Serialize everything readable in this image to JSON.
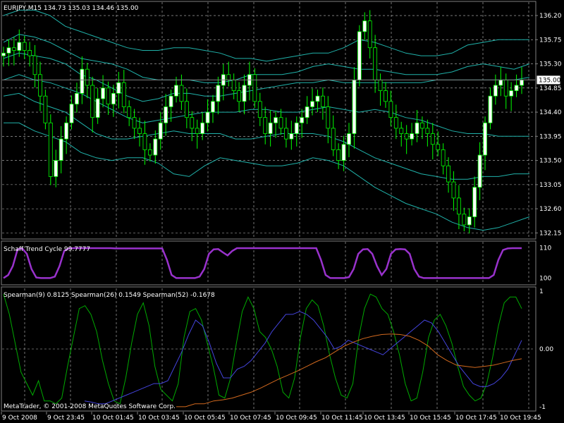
{
  "colors": {
    "background": "#000000",
    "grid": "#c0c0c0",
    "axis_text": "#ffffff",
    "bull_candle": "#ffffff",
    "bear_candle": "#000000",
    "candle_outline": "#00ff00",
    "bands": "#20b2aa",
    "schaff": "#9932cc",
    "spearman_9": "#00aa00",
    "spearman_26": "#4444dd",
    "spearman_52": "#d2691e"
  },
  "header": {
    "symbol_line": "EURJPY,M15  134.73 135.03 134.46 135.00"
  },
  "panels": {
    "schaff_label": "Schaff Trend Cycle 99.7777",
    "spearman_label": "Spearman(9) 0.8125  Spearman(26) 0.1549  Spearman(52) -0.1678",
    "copyright": "MetaTrader, © 2001-2008 MetaQuotes Software Corp."
  },
  "chart_data": [
    {
      "type": "candlestick",
      "title": "EURJPY,M15",
      "ohlc_header": {
        "open": 134.73,
        "high": 135.03,
        "low": 134.46,
        "close": 135.0
      },
      "current_price": "135.00",
      "ylim": [
        132.05,
        136.45
      ],
      "y_ticks": [
        "136.20",
        "135.75",
        "135.30",
        "134.85",
        "134.40",
        "133.95",
        "133.50",
        "133.05",
        "132.60",
        "132.15"
      ],
      "y_tick_values": [
        136.2,
        135.75,
        135.3,
        134.85,
        134.4,
        133.95,
        133.5,
        133.05,
        132.6,
        132.15
      ],
      "x_labels": [
        "9 Oct 2008",
        "9 Oct 23:45",
        "10 Oct 01:45",
        "10 Oct 03:45",
        "10 Oct 05:45",
        "10 Oct 07:45",
        "10 Oct 09:45",
        "10 Oct 11:45",
        "10 Oct 13:45",
        "10 Oct 15:45",
        "10 Oct 17:45",
        "10 Oct 19:45"
      ],
      "closes": [
        135.5,
        135.6,
        135.55,
        135.7,
        135.55,
        135.45,
        135.1,
        134.7,
        134.2,
        133.2,
        133.5,
        133.9,
        134.2,
        134.55,
        134.75,
        135.2,
        134.9,
        134.3,
        134.65,
        134.85,
        134.55,
        134.75,
        134.95,
        134.5,
        134.3,
        134.1,
        134.0,
        133.7,
        133.6,
        133.9,
        134.2,
        134.5,
        134.7,
        134.9,
        134.6,
        134.3,
        134.1,
        134.0,
        134.2,
        134.4,
        134.6,
        134.9,
        135.1,
        135.0,
        134.8,
        134.6,
        134.9,
        135.1,
        134.6,
        134.3,
        134.0,
        134.2,
        134.3,
        134.1,
        133.9,
        134.0,
        134.2,
        134.3,
        134.5,
        134.6,
        134.7,
        134.5,
        134.1,
        133.7,
        133.5,
        133.8,
        134.0,
        135.0,
        135.9,
        136.1,
        135.6,
        135.0,
        134.8,
        134.6,
        134.3,
        134.1,
        134.0,
        133.9,
        134.0,
        134.2,
        134.1,
        134.0,
        133.8,
        133.7,
        133.4,
        133.1,
        132.8,
        132.5,
        132.3,
        132.45,
        133.0,
        133.6,
        134.2,
        134.7,
        134.9,
        135.0,
        134.7,
        134.8,
        134.9,
        135.0
      ],
      "bands": [
        [
          136.2,
          136.3,
          136.3,
          136.2,
          136.0,
          135.9,
          135.8,
          135.7,
          135.6,
          135.55,
          135.55,
          135.6,
          135.6,
          135.55,
          135.5,
          135.4,
          135.4,
          135.35,
          135.4,
          135.45,
          135.5,
          135.5,
          135.6,
          135.75,
          135.7,
          135.6,
          135.5,
          135.45,
          135.45,
          135.5,
          135.65,
          135.7,
          135.75,
          135.75,
          135.75
        ],
        [
          135.7,
          135.85,
          135.8,
          135.7,
          135.55,
          135.4,
          135.35,
          135.3,
          135.2,
          135.05,
          135.0,
          135.0,
          135.0,
          134.95,
          134.95,
          135.0,
          135.1,
          135.1,
          135.1,
          135.15,
          135.25,
          135.3,
          135.25,
          135.2,
          135.2,
          135.15,
          135.1,
          135.1,
          135.1,
          135.15,
          135.25,
          135.3,
          135.25,
          135.2,
          135.3
        ],
        [
          135.4,
          135.5,
          135.45,
          135.4,
          135.3,
          135.1,
          135.0,
          134.85,
          134.7,
          134.6,
          134.65,
          134.75,
          134.75,
          134.7,
          134.7,
          134.75,
          134.8,
          134.85,
          134.9,
          134.95,
          134.95,
          135.0,
          134.95,
          134.95,
          134.95,
          134.95,
          134.95,
          134.95,
          135.0,
          135.0,
          135.0,
          135.0,
          135.0,
          135.0,
          135.05
        ],
        [
          135.0,
          135.1,
          135.0,
          134.95,
          134.85,
          134.75,
          134.6,
          134.45,
          134.3,
          134.2,
          134.25,
          134.3,
          134.35,
          134.4,
          134.4,
          134.4,
          134.45,
          134.45,
          134.4,
          134.4,
          134.45,
          134.5,
          134.45,
          134.4,
          134.45,
          134.4,
          134.3,
          134.25,
          134.15,
          134.05,
          134.0,
          134.0,
          133.95,
          133.95,
          133.95
        ],
        [
          134.7,
          134.75,
          134.6,
          134.5,
          134.4,
          134.2,
          134.0,
          133.9,
          133.9,
          133.95,
          134.0,
          134.05,
          134.0,
          134.0,
          134.0,
          133.9,
          133.9,
          133.95,
          134.0,
          134.0,
          134.0,
          133.95,
          133.85,
          133.7,
          133.55,
          133.45,
          133.35,
          133.25,
          133.2,
          133.15,
          133.15,
          133.2,
          133.2,
          133.25,
          133.25
        ],
        [
          134.2,
          134.2,
          134.05,
          133.95,
          133.85,
          133.65,
          133.55,
          133.5,
          133.55,
          133.55,
          133.45,
          133.25,
          133.2,
          133.4,
          133.55,
          133.5,
          133.45,
          133.4,
          133.4,
          133.45,
          133.55,
          133.5,
          133.4,
          133.2,
          133.0,
          132.85,
          132.7,
          132.6,
          132.5,
          132.35,
          132.25,
          132.2,
          132.25,
          132.35,
          132.45
        ]
      ]
    },
    {
      "type": "line",
      "title": "Schaff Trend Cycle 99.7777",
      "y_ticks": [
        "110",
        "100"
      ],
      "ylim": [
        98,
        112
      ],
      "series": [
        {
          "name": "Schaff Trend Cycle",
          "values": [
            100,
            101,
            104,
            109.5,
            109.8,
            108,
            103,
            100.2,
            100,
            100,
            100,
            100.5,
            104,
            109,
            109.8,
            109.9,
            109.9,
            109.9,
            109.9,
            109.9,
            109.9,
            109.9,
            109.9,
            109.9,
            109.8,
            109.8,
            109.8,
            109.8,
            109.8,
            109.8,
            109.8,
            109.8,
            109.8,
            109.8,
            109.8,
            106,
            101,
            100,
            100,
            100,
            100,
            100,
            100.5,
            103,
            108,
            109.5,
            109.6,
            108.5,
            107.5,
            109,
            109.9,
            109.9,
            109.9,
            109.9,
            109.9,
            109.9,
            109.9,
            109.9,
            109.9,
            109.9,
            109.9,
            109.9,
            109.9,
            109.9,
            109.9,
            109.9,
            109.9,
            109.9,
            106,
            101,
            100,
            100,
            100,
            100,
            100.3,
            103,
            108,
            109.5,
            109.6,
            108,
            104,
            101,
            103,
            108,
            109.5,
            109.6,
            109.5,
            108,
            103,
            100.5,
            100,
            100,
            100,
            100,
            100,
            100,
            100,
            100,
            100,
            100,
            100,
            100,
            100,
            100,
            100,
            101,
            106,
            109.3,
            109.8,
            109.9,
            109.9,
            109.9
          ]
        }
      ]
    },
    {
      "type": "line",
      "title": "Spearman(9) 0.8125  Spearman(26) 0.1549  Spearman(52) -0.1678",
      "y_ticks": [
        "1",
        "0.00",
        "-1"
      ],
      "ylim": [
        -1.05,
        1.05
      ],
      "series": [
        {
          "name": "Spearman(9)",
          "values": [
            0.95,
            0.6,
            0.1,
            -0.4,
            -0.6,
            -0.8,
            -0.55,
            -0.9,
            -0.9,
            -0.95,
            -0.85,
            -0.3,
            0.2,
            0.7,
            0.75,
            0.6,
            0.3,
            -0.2,
            -0.6,
            -0.9,
            -0.95,
            -0.5,
            0.1,
            0.6,
            0.8,
            0.4,
            -0.3,
            -0.7,
            -0.8,
            -0.9,
            -0.6,
            0.2,
            0.65,
            0.7,
            0.5,
            0.1,
            -0.3,
            -0.8,
            -0.85,
            -0.5,
            0.1,
            0.65,
            0.9,
            0.7,
            0.3,
            0.2,
            0.0,
            -0.3,
            -0.75,
            -0.85,
            -0.5,
            0.2,
            0.7,
            0.85,
            0.75,
            0.4,
            -0.1,
            -0.5,
            -0.8,
            -0.85,
            -0.6,
            0.2,
            0.7,
            0.95,
            0.9,
            0.7,
            0.6,
            0.3,
            -0.1,
            -0.6,
            -0.9,
            -0.85,
            -0.4,
            0.2,
            0.5,
            0.6,
            0.4,
            0.1,
            -0.3,
            -0.65,
            -0.8,
            -0.9,
            -0.85,
            -0.6,
            -0.15,
            0.4,
            0.8,
            0.9,
            0.9,
            0.7
          ]
        },
        {
          "name": "Spearman(26)",
          "values": [
            -0.9,
            -0.92,
            -0.95,
            -0.95,
            -0.9,
            -0.85,
            -0.8,
            -0.75,
            -0.7,
            -0.65,
            -0.6,
            -0.6,
            -0.55,
            -0.3,
            -0.05,
            0.25,
            0.5,
            0.4,
            0.1,
            -0.25,
            -0.5,
            -0.5,
            -0.35,
            -0.3,
            -0.2,
            -0.05,
            0.1,
            0.3,
            0.45,
            0.6,
            0.6,
            0.65,
            0.6,
            0.5,
            0.35,
            0.2,
            0.0,
            0.05,
            0.15,
            0.1,
            0.05,
            0.0,
            -0.05,
            -0.1,
            0.0,
            0.1,
            0.2,
            0.3,
            0.4,
            0.5,
            0.45,
            0.3,
            0.1,
            -0.1,
            -0.3,
            -0.45,
            -0.6,
            -0.65,
            -0.65,
            -0.6,
            -0.5,
            -0.35,
            -0.1,
            0.15
          ]
        },
        {
          "name": "Spearman(52)",
          "values": [
            -1.0,
            -1.0,
            -0.95,
            -0.95,
            -0.9,
            -0.88,
            -0.85,
            -0.8,
            -0.75,
            -0.68,
            -0.6,
            -0.52,
            -0.45,
            -0.38,
            -0.3,
            -0.22,
            -0.15,
            -0.05,
            0.05,
            0.12,
            0.18,
            0.22,
            0.25,
            0.26,
            0.25,
            0.22,
            0.15,
            0.05,
            -0.1,
            -0.2,
            -0.28,
            -0.3,
            -0.32,
            -0.3,
            -0.28,
            -0.24,
            -0.2,
            -0.17
          ]
        }
      ]
    }
  ]
}
